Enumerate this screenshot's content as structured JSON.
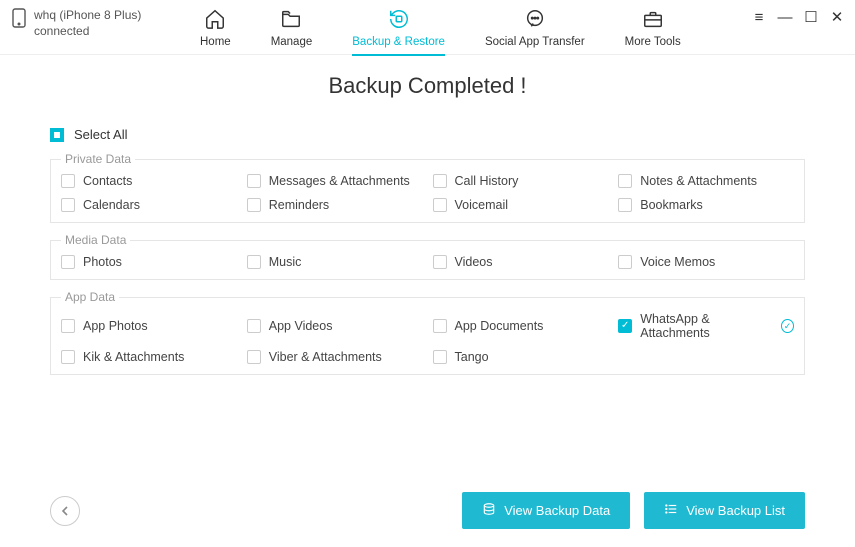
{
  "device": {
    "name": "whq (iPhone 8 Plus)",
    "status": "connected"
  },
  "nav": {
    "home": "Home",
    "manage": "Manage",
    "backup_restore": "Backup & Restore",
    "social": "Social App Transfer",
    "more": "More Tools"
  },
  "heading": "Backup Completed !",
  "select_all": "Select All",
  "groups": {
    "private": {
      "legend": "Private Data",
      "items": [
        "Contacts",
        "Messages & Attachments",
        "Call History",
        "Notes & Attachments",
        "Calendars",
        "Reminders",
        "Voicemail",
        "Bookmarks"
      ]
    },
    "media": {
      "legend": "Media Data",
      "items": [
        "Photos",
        "Music",
        "Videos",
        "Voice Memos"
      ]
    },
    "app": {
      "legend": "App Data",
      "items": [
        "App Photos",
        "App Videos",
        "App Documents",
        "WhatsApp & Attachments",
        "Kik & Attachments",
        "Viber & Attachments",
        "Tango"
      ]
    }
  },
  "checked_item": "WhatsApp & Attachments",
  "buttons": {
    "view_data": "View Backup Data",
    "view_list": "View Backup List"
  }
}
